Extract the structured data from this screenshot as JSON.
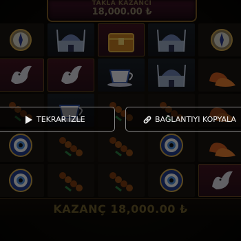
{
  "top_banner": {
    "label": "TAKLA KAZANCI",
    "amount": "18,000.00 ₺"
  },
  "bottom_bar": {
    "win_text": "KAZANÇ 18,000.00 ₺"
  },
  "actions": {
    "replay_label": "TEKRAR İZLE",
    "replay_icon": "play-icon",
    "copy_label": "BAĞLANTIYI KOPYALA",
    "copy_icon": "link-icon"
  },
  "reels": [
    [
      "compass",
      "palace",
      "treasure-chest",
      "palace",
      "compass"
    ],
    [
      "dove",
      "dove",
      "teacup",
      "palace",
      "slippers"
    ],
    [
      "prayer-beads",
      "teacup",
      "prayer-beads",
      "prayer-beads",
      "slippers"
    ],
    [
      "evil-eye",
      "prayer-beads",
      "prayer-beads",
      "evil-eye",
      "slippers"
    ],
    [
      "evil-eye",
      "prayer-beads",
      "prayer-beads",
      "evil-eye",
      "dove"
    ]
  ]
}
